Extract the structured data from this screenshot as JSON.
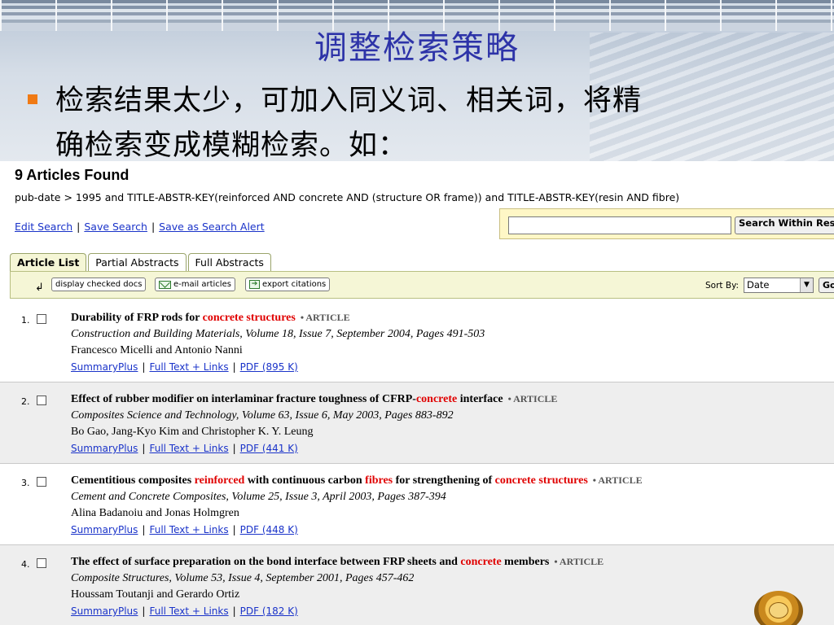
{
  "slide": {
    "title": "调整检索策略",
    "bullet_line1": "检索结果太少，可加入同义词、相关词，将精",
    "bullet_line2": "确检索变成模糊检索。如："
  },
  "screen": {
    "found_title": "9 Articles Found",
    "query": "pub-date > 1995 and TITLE-ABSTR-KEY(reinforced AND concrete AND (structure OR frame)) and TITLE-ABSTR-KEY(resin AND fibre)",
    "links": [
      "Edit Search",
      "Save Search",
      "Save as Search Alert"
    ],
    "search_within": {
      "value": "",
      "button_label": "Search Within Results"
    },
    "tabs": [
      "Article List",
      "Partial Abstracts",
      "Full Abstracts"
    ],
    "toolbar": {
      "display_checked": "display checked docs",
      "email": "e-mail articles",
      "export": "export citations",
      "sort_label": "Sort By:",
      "sort_value": "Date",
      "go_label": "Go"
    },
    "results": [
      {
        "num": "1.",
        "title_parts": [
          {
            "text": "Durability of FRP rods for ",
            "hl": false
          },
          {
            "text": "concrete structures",
            "hl": true
          }
        ],
        "type": "• ARTICLE",
        "source": "Construction and Building Materials, Volume 18, Issue 7, September 2004, Pages 491-503",
        "authors": "Francesco Micelli and Antonio Nanni",
        "links": [
          "SummaryPlus",
          "Full Text + Links",
          "PDF (895 K)"
        ]
      },
      {
        "num": "2.",
        "title_parts": [
          {
            "text": "Effect of rubber modifier on interlaminar fracture toughness of CFRP-",
            "hl": false
          },
          {
            "text": "concrete",
            "hl": true
          },
          {
            "text": " interface",
            "hl": false
          }
        ],
        "type": "• ARTICLE",
        "source": "Composites Science and Technology, Volume 63, Issue 6, May 2003, Pages 883-892",
        "authors": "Bo Gao, Jang-Kyo Kim and Christopher K. Y. Leung",
        "links": [
          "SummaryPlus",
          "Full Text + Links",
          "PDF (441 K)"
        ]
      },
      {
        "num": "3.",
        "title_parts": [
          {
            "text": "Cementitious composites ",
            "hl": false
          },
          {
            "text": "reinforced",
            "hl": true
          },
          {
            "text": " with continuous carbon ",
            "hl": false
          },
          {
            "text": "fibres",
            "hl": true
          },
          {
            "text": " for strengthening of ",
            "hl": false
          },
          {
            "text": "concrete structures",
            "hl": true
          }
        ],
        "type": "• ARTICLE",
        "source": "Cement and Concrete Composites, Volume 25, Issue 3, April 2003, Pages 387-394",
        "authors": "Alina Badanoiu and Jonas Holmgren",
        "links": [
          "SummaryPlus",
          "Full Text + Links",
          "PDF (448 K)"
        ]
      },
      {
        "num": "4.",
        "title_parts": [
          {
            "text": "The effect of surface preparation on the bond interface between FRP sheets and ",
            "hl": false
          },
          {
            "text": "concrete",
            "hl": true
          },
          {
            "text": " members",
            "hl": false
          }
        ],
        "type": "• ARTICLE",
        "source": "Composite Structures, Volume 53, Issue 4, September 2001, Pages 457-462",
        "authors": "Houssam Toutanji and Gerardo Ortiz",
        "links": [
          "SummaryPlus",
          "Full Text + Links",
          "PDF (182 K)"
        ]
      }
    ]
  },
  "colors": {
    "title": "#2d33a8",
    "bullet": "#f07a14",
    "link": "#1a33c9",
    "highlight": "#e00000",
    "toolbar_bg": "#f5f6d6",
    "search_bg": "#fff7c6"
  }
}
